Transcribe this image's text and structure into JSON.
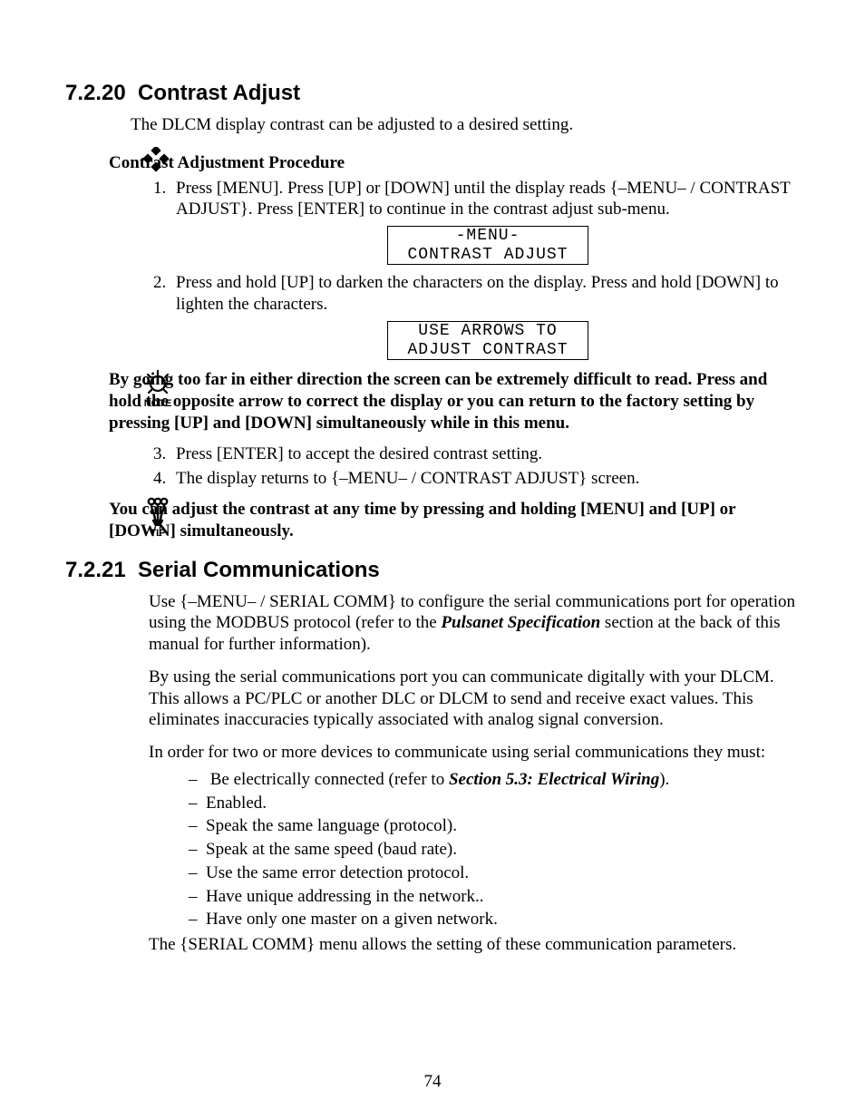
{
  "section1": {
    "num": "7.2.20",
    "title": "Contrast Adjust",
    "intro": "The DLCM display contrast can be adjusted to a desired setting.",
    "proc_heading": "Contrast Adjustment Procedure",
    "step1": "Press [MENU].  Press [UP] or [DOWN] until the display reads {–MENU– / CONTRAST ADJUST}.  Press [ENTER] to continue in the contrast adjust sub-menu.",
    "lcd1_l1": "-MENU-",
    "lcd1_l2": "CONTRAST ADJUST",
    "step2": "Press and hold [UP] to darken the characters on the display.  Press and hold [DOWN] to lighten the characters.",
    "lcd2_l1": "USE ARROWS TO",
    "lcd2_l2": "ADJUST CONTRAST",
    "note_label": "NOTE",
    "note_text": "By going too far in either direction the screen can be extremely difficult to read.  Press and hold the opposite arrow to correct the display or you can return to the factory setting by pressing [UP] and [DOWN] simultaneously while in this menu.",
    "step3": "Press [ENTER] to accept the desired contrast setting.",
    "step4": "The display returns to {–MENU– / CONTRAST ADJUST} screen.",
    "tip_label": "TIP",
    "tip_text": "You can adjust the contrast at any time by pressing and holding [MENU] and [UP] or [DOWN] simultaneously."
  },
  "section2": {
    "num": "7.2.21",
    "title": "Serial Communications",
    "p1a": "Use {–MENU– / SERIAL COMM} to configure the serial communications port for operation using the MODBUS protocol (refer to the ",
    "p1b": "Pulsanet Specification",
    "p1c": " section at the back of this manual for further information).",
    "p2": "By using the serial communications port you can communicate digitally with your DLCM.  This allows a PC/PLC or another DLC or DLCM to send and receive exact values.  This eliminates inaccuracies typically associated with analog signal conversion.",
    "p3": "In order for two or more devices to communicate using serial communications they must:",
    "b1a": "Be electrically connected (refer to ",
    "b1b": "Section 5.3: Electrical Wiring",
    "b1c": ").",
    "b2": "Enabled.",
    "b3": "Speak the same language (protocol).",
    "b4": "Speak at the same speed (baud rate).",
    "b5": "Use the same error detection protocol.",
    "b6": "Have unique addressing in the network..",
    "b7": "Have only one master on a given network.",
    "p4": "The {SERIAL COMM} menu allows the setting of these communication parameters."
  },
  "page_number": "74"
}
